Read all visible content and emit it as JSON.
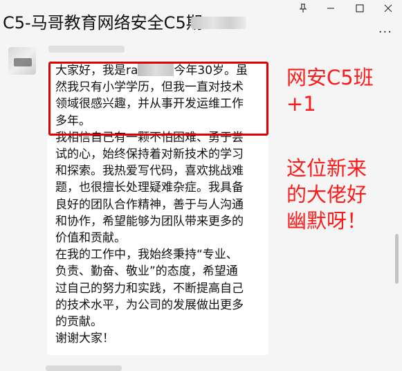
{
  "window": {
    "title": "C5-马哥教育网络安全C5期",
    "controls": {
      "pin_icon": "pin-icon",
      "minimize_icon": "minimize-icon",
      "maximize_icon": "maximize-icon",
      "close_icon": "close-icon",
      "more_label": "···"
    }
  },
  "message": {
    "lines_highlighted": [
      "大家好，我是ra",
      "然我只有小学学历，但我一直对技术",
      "领域很感兴趣，并从事开发运维工作",
      "多年。"
    ],
    "line1_suffix": "今年30岁。虽",
    "lines_rest": [
      "我相信自己有一颗不怕困难、勇于尝",
      "试的心，始终保持着对新技术的学习",
      "和探索。我热爱写代码，喜欢挑战难",
      "题，也很擅长处理疑难杂症。我具备",
      "良好的团队合作精神，善于与人沟通",
      "和协作，希望能够为团队带来更多的",
      "价值和贡献。",
      "在我的工作中，我始终秉持“专业、",
      "负责、勤奋、敬业”的态度，希望通",
      "过自己的努力和实践，不断提高自己",
      "的技术水平，为公司的发展做出更多",
      "的贡献。",
      "谢谢大家！"
    ]
  },
  "annotations": {
    "text1_line1": "网安C5班",
    "text1_line2": "+1",
    "text2_line1": "这位新来",
    "text2_line2": "的大佬好",
    "text2_line3": "幽默呀！",
    "color": "#ff1a1a"
  },
  "colors": {
    "highlight_box": "#e00000",
    "background": "#f5f5f5",
    "bubble": "#ffffff"
  }
}
